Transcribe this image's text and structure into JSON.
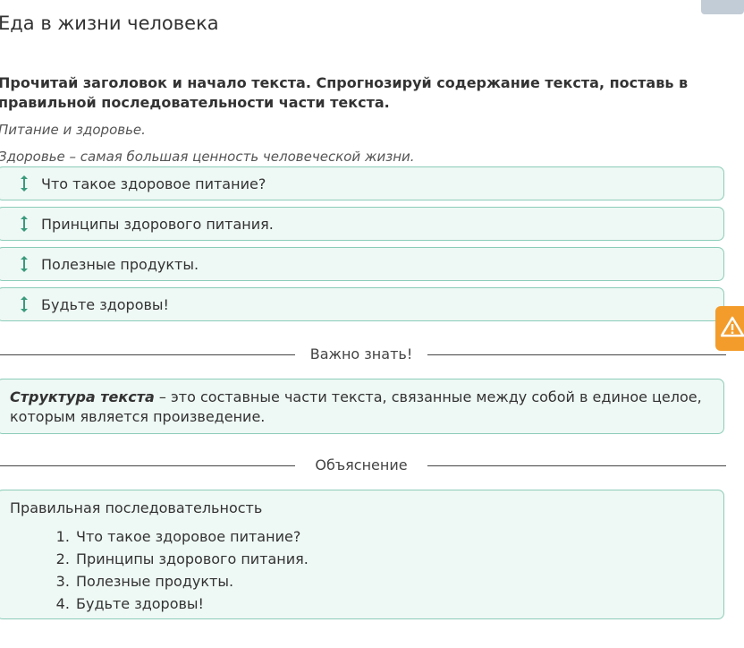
{
  "header": {
    "title": "Еда в жизни человека"
  },
  "task": {
    "instruction": "Прочитай заголовок и начало текста. Спрогнозируй содержание текста, поставь в правильной последовательности части текста.",
    "heading": "Питание и здоровье.",
    "beginning": "Здоровье – самая большая ценность человеческой жизни."
  },
  "drag_items": [
    {
      "label": "Что такое здоровое питание?"
    },
    {
      "label": "Принципы здорового питания."
    },
    {
      "label": "Полезные продукты."
    },
    {
      "label": "Будьте здоровы!"
    }
  ],
  "important": {
    "divider_label": "Важно знать!",
    "term": "Структура текста",
    "definition": " – это составные части текста, связанные между собой в единое целое, которым является произведение."
  },
  "explanation": {
    "divider_label": "Объяснение",
    "heading": "Правильная последовательность",
    "items": [
      "Что такое здоровое питание?",
      "Принципы здорового питания.",
      "Полезные продукты.",
      "Будьте здоровы!"
    ]
  },
  "icons": {
    "drag": "drag-vertical-icon",
    "warning": "warning-icon"
  },
  "colors": {
    "item_border": "#8ccdb9",
    "item_bg": "#eef8f4",
    "drag_icon": "#3a9a7c",
    "warning": "#f39c2b"
  }
}
